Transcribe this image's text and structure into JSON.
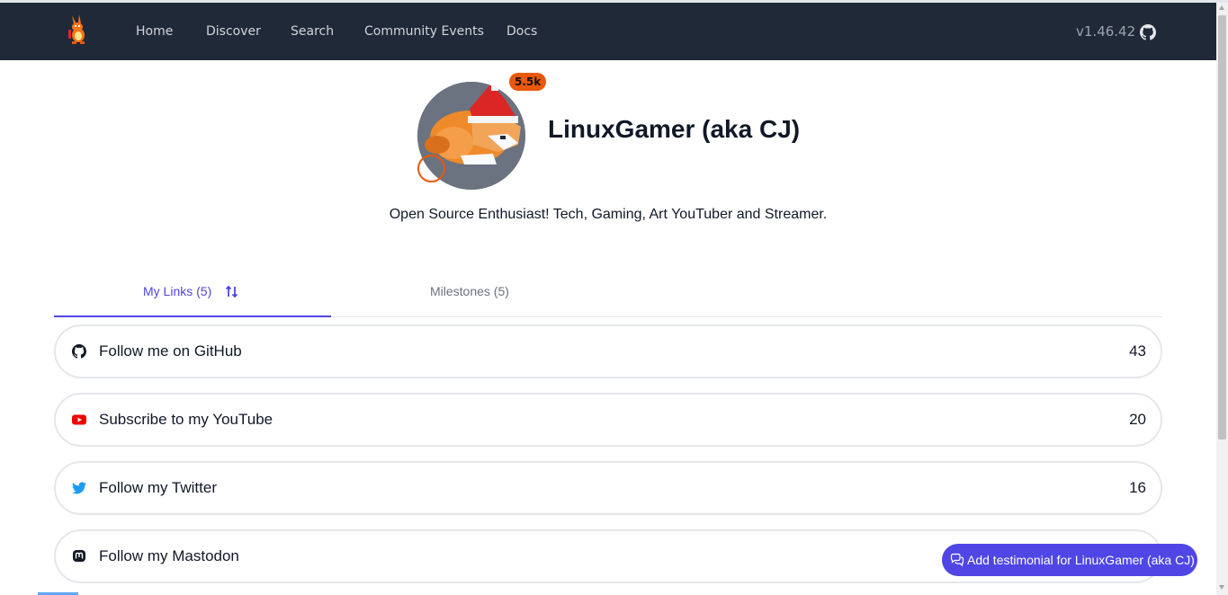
{
  "nav": {
    "links": [
      "Home",
      "Discover",
      "Search",
      "Community Events",
      "Docs"
    ],
    "version": "v1.46.42"
  },
  "profile": {
    "name": "LinuxGamer (aka CJ)",
    "views_badge": "5.5k",
    "bio": "Open Source Enthusiast! Tech, Gaming, Art YouTuber and Streamer."
  },
  "tabs": {
    "links_label": "My Links (5)",
    "milestones_label": "Milestones (5)"
  },
  "links": [
    {
      "label": "Follow me on GitHub",
      "count": "43",
      "icon": "github-icon",
      "color": "#111827"
    },
    {
      "label": "Subscribe to my YouTube",
      "count": "20",
      "icon": "youtube-icon",
      "color": "#ef0000"
    },
    {
      "label": "Follow my Twitter",
      "count": "16",
      "icon": "twitter-icon",
      "color": "#1d9bf0"
    },
    {
      "label": "Follow my Mastodon",
      "count": "",
      "icon": "mastodon-icon",
      "color": "#111827"
    }
  ],
  "testimonial_button": "Add testimonial for LinuxGamer (aka CJ)",
  "colors": {
    "nav_bg": "#1f2937",
    "accent": "#4f46e5",
    "badge": "#ea580c"
  }
}
